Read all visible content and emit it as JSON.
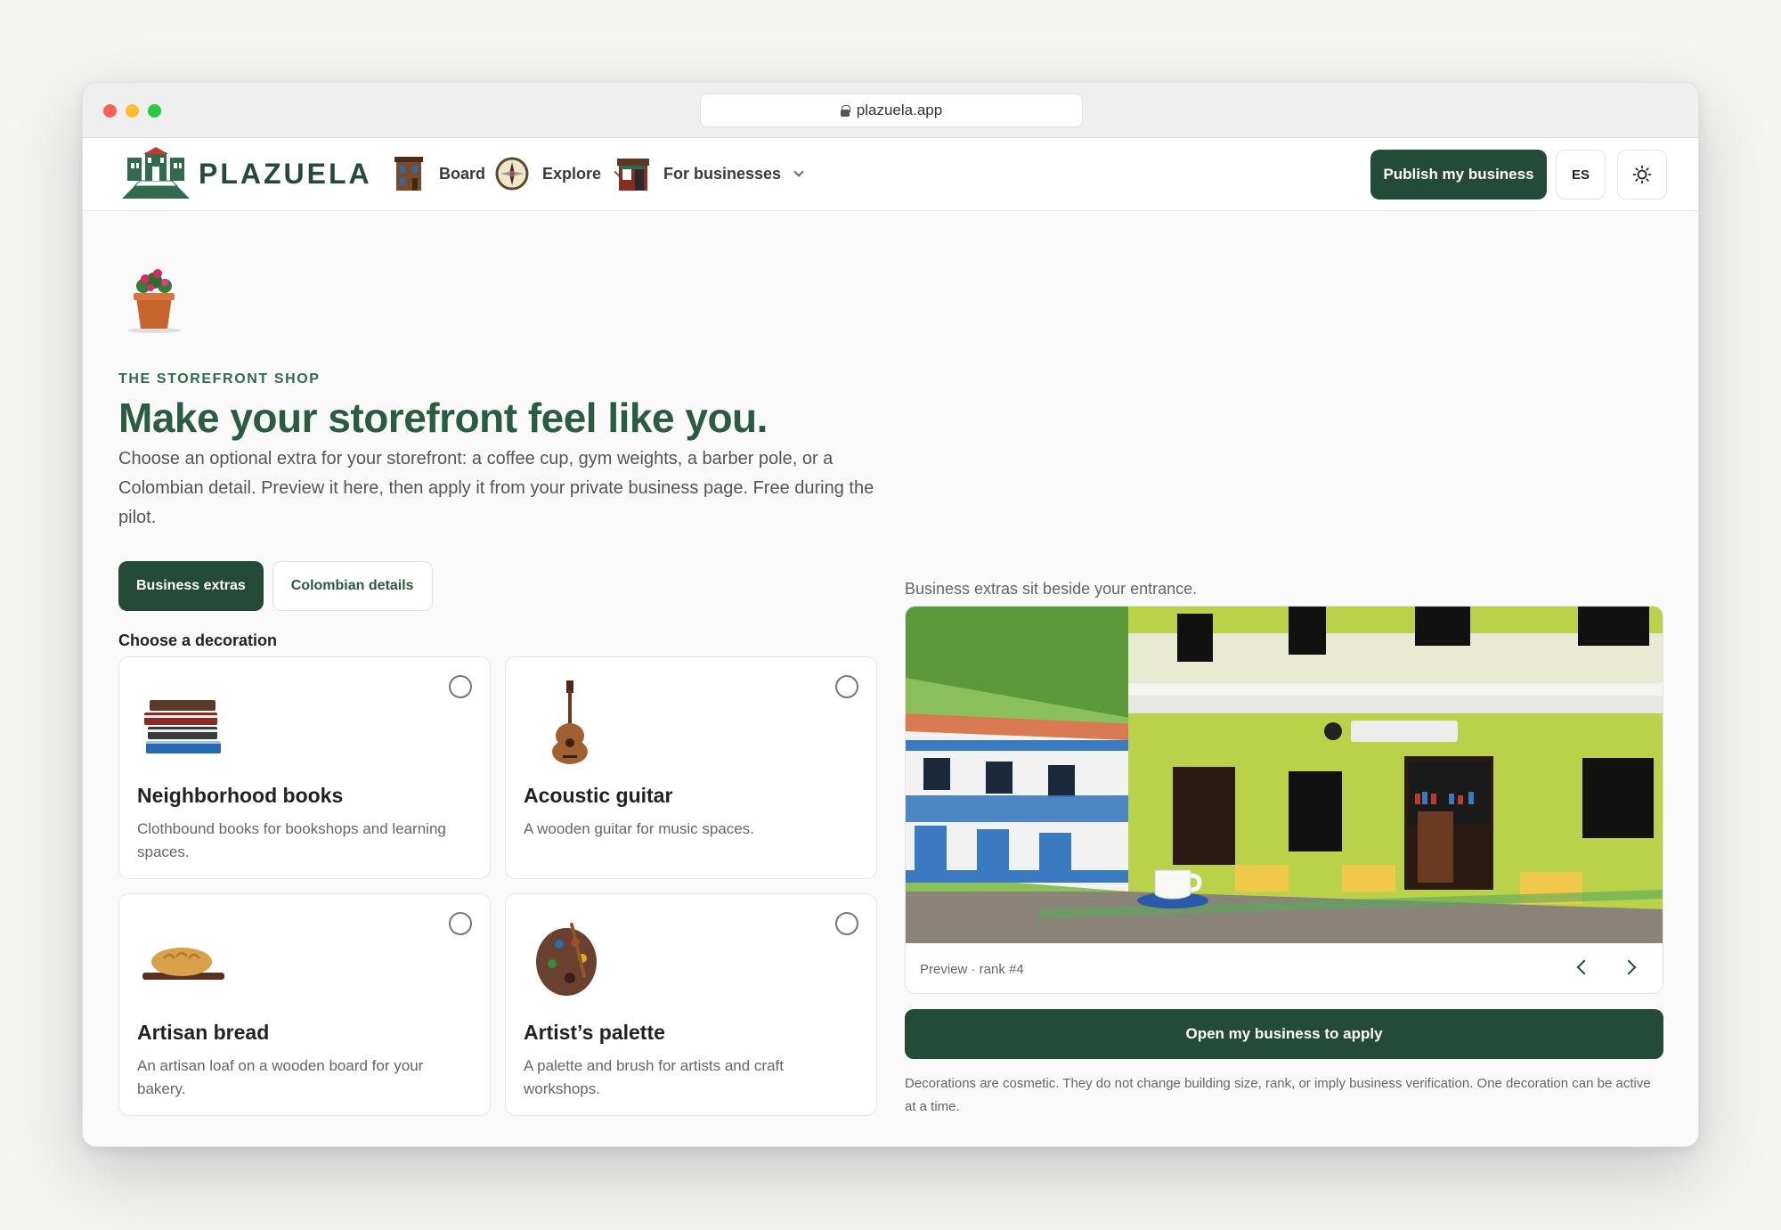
{
  "browser": {
    "url": "plazuela.app"
  },
  "nav": {
    "brand": "PLAZUELA",
    "items": [
      {
        "label": "Board",
        "icon": "building-icon",
        "has_dropdown": false
      },
      {
        "label": "Explore",
        "icon": "compass-icon",
        "has_dropdown": true
      },
      {
        "label": "For businesses",
        "icon": "storefront-icon",
        "has_dropdown": true
      }
    ],
    "publish_label": "Publish my business",
    "lang_label": "ES",
    "theme_icon": "sun-icon"
  },
  "hero": {
    "icon": "flower-pot-icon",
    "eyebrow": "THE STOREFRONT SHOP",
    "title": "Make your storefront feel like you.",
    "lede": "Choose an optional extra for your storefront: a coffee cup, gym weights, a barber pole, or a Colombian detail. Preview it here, then apply it from your private business page. Free during the pilot."
  },
  "tabs": [
    {
      "label": "Business extras",
      "active": true
    },
    {
      "label": "Colombian details",
      "active": false
    }
  ],
  "decorations": {
    "label": "Choose a decoration",
    "items": [
      {
        "title": "Neighborhood books",
        "desc": "Clothbound books for bookshops and learning spaces.",
        "icon": "books-icon",
        "selected": false
      },
      {
        "title": "Acoustic guitar",
        "desc": "A wooden guitar for music spaces.",
        "icon": "guitar-icon",
        "selected": false
      },
      {
        "title": "Artisan bread",
        "desc": "An artisan loaf on a wooden board for your bakery.",
        "icon": "bread-icon",
        "selected": false
      },
      {
        "title": "Artist’s palette",
        "desc": "A palette and brush for artists and craft workshops.",
        "icon": "palette-icon",
        "selected": false
      }
    ]
  },
  "preview": {
    "caption": "Business extras sit beside your entrance.",
    "footer": "Preview · rank #4",
    "apply_label": "Open my business to apply",
    "note": "Decorations are cosmetic. They do not change building size, rank, or imply business verification. One decoration can be active at a time."
  },
  "colors": {
    "accent": "#244a3a",
    "heading": "#2a5c42",
    "facade": "#b9d24a"
  }
}
